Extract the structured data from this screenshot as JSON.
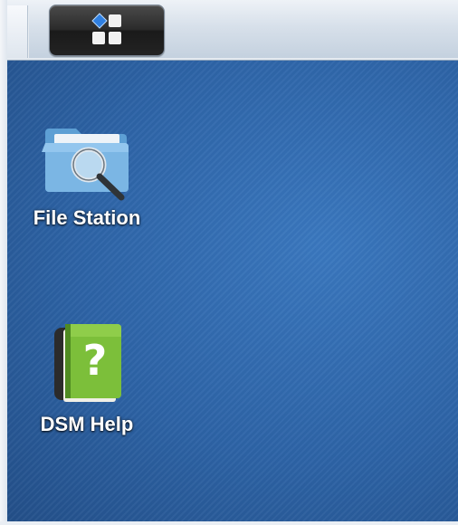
{
  "taskbar": {
    "main_menu": {
      "icon": "main-menu-grid-icon"
    }
  },
  "desktop": {
    "icons": [
      {
        "label": "File Station",
        "icon": "file-station-icon"
      },
      {
        "label": "DSM Help",
        "icon": "dsm-help-icon"
      }
    ]
  },
  "colors": {
    "desktop_background": "#2f66a8",
    "taskbar": "#d7e0ea",
    "menu_button": "#2b2b2b",
    "grid_accent": "#2f7fe0",
    "help_book": "#7cbf3a"
  }
}
